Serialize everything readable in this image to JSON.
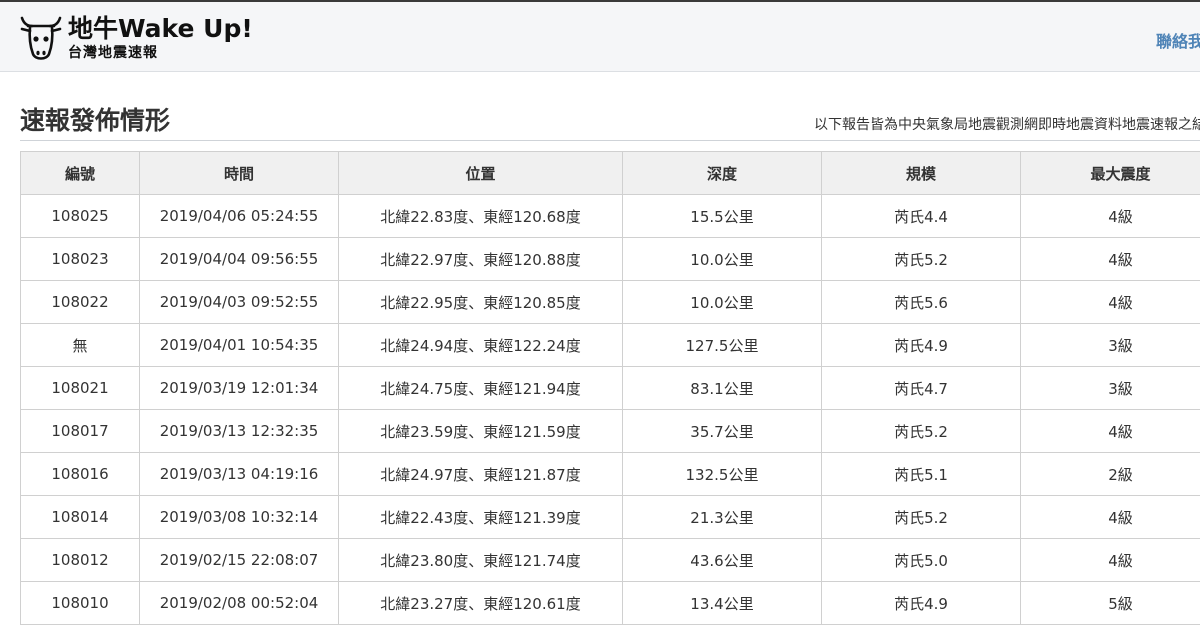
{
  "header": {
    "brand_title": "地牛Wake Up!",
    "brand_subtitle": "台灣地震速報",
    "contact_label": "聯絡我"
  },
  "main": {
    "title": "速報發佈情形",
    "description": "以下報告皆為中央氣象局地震觀測網即時地震資料地震速報之結"
  },
  "table": {
    "headers": [
      "編號",
      "時間",
      "位置",
      "深度",
      "規模",
      "最大震度"
    ],
    "rows": [
      [
        "108025",
        "2019/04/06 05:24:55",
        "北緯22.83度、東經120.68度",
        "15.5公里",
        "芮氏4.4",
        "4級"
      ],
      [
        "108023",
        "2019/04/04 09:56:55",
        "北緯22.97度、東經120.88度",
        "10.0公里",
        "芮氏5.2",
        "4級"
      ],
      [
        "108022",
        "2019/04/03 09:52:55",
        "北緯22.95度、東經120.85度",
        "10.0公里",
        "芮氏5.6",
        "4級"
      ],
      [
        "無",
        "2019/04/01 10:54:35",
        "北緯24.94度、東經122.24度",
        "127.5公里",
        "芮氏4.9",
        "3級"
      ],
      [
        "108021",
        "2019/03/19 12:01:34",
        "北緯24.75度、東經121.94度",
        "83.1公里",
        "芮氏4.7",
        "3級"
      ],
      [
        "108017",
        "2019/03/13 12:32:35",
        "北緯23.59度、東經121.59度",
        "35.7公里",
        "芮氏5.2",
        "4級"
      ],
      [
        "108016",
        "2019/03/13 04:19:16",
        "北緯24.97度、東經121.87度",
        "132.5公里",
        "芮氏5.1",
        "2級"
      ],
      [
        "108014",
        "2019/03/08 10:32:14",
        "北緯22.43度、東經121.39度",
        "21.3公里",
        "芮氏5.2",
        "4級"
      ],
      [
        "108012",
        "2019/02/15 22:08:07",
        "北緯23.80度、東經121.74度",
        "43.6公里",
        "芮氏5.0",
        "4級"
      ],
      [
        "108010",
        "2019/02/08 00:52:04",
        "北緯23.27度、東經120.61度",
        "13.4公里",
        "芮氏4.9",
        "5級"
      ]
    ]
  },
  "colors": {
    "link": "#4f84b7",
    "header_bg": "#f5f6f8",
    "table_header_bg": "#f0f0f0"
  },
  "icons": {
    "logo": "cow-head-icon"
  }
}
